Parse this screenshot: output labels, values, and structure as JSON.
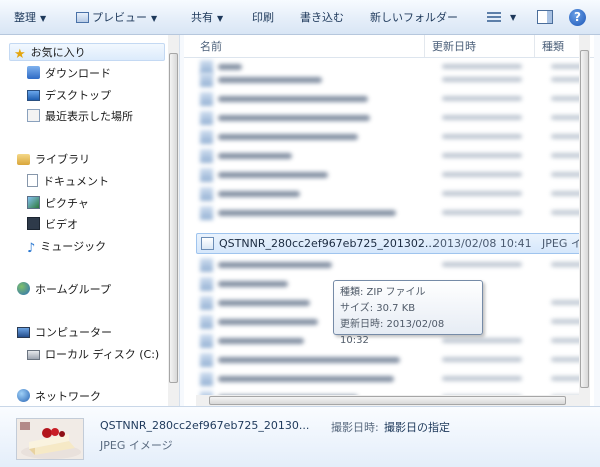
{
  "toolbar": {
    "organize_label": "整理",
    "preview_label": "プレビュー",
    "share_label": "共有",
    "print_label": "印刷",
    "burn_label": "書き込む",
    "new_folder_label": "新しいフォルダー",
    "help_glyph": "?"
  },
  "nav": {
    "favorites": {
      "label": "お気に入り",
      "items": [
        {
          "label": "ダウンロード"
        },
        {
          "label": "デスクトップ"
        },
        {
          "label": "最近表示した場所"
        }
      ]
    },
    "libraries": {
      "label": "ライブラリ",
      "items": [
        {
          "label": "ドキュメント"
        },
        {
          "label": "ピクチャ"
        },
        {
          "label": "ビデオ"
        },
        {
          "label": "ミュージック"
        }
      ]
    },
    "homegroup": {
      "label": "ホームグループ"
    },
    "computer": {
      "label": "コンピューター",
      "items": [
        {
          "label": "ローカル ディスク (C:)"
        }
      ]
    },
    "network": {
      "label": "ネットワーク"
    }
  },
  "columns": {
    "name": "名前",
    "modified": "更新日時",
    "type": "種類"
  },
  "selected_file": {
    "name": "QSTNNR_280cc2ef967eb725_201302...",
    "date": "2013/02/08 10:41",
    "type": "JPEG イ"
  },
  "tooltip": {
    "type_line": "種類: ZIP ファイル",
    "size_line": "サイズ: 30.7 KB",
    "modified_line": "更新日時: 2013/02/08 10:32"
  },
  "details": {
    "file_name": "QSTNNR_280cc2ef967eb725_20130...",
    "prop_label": "撮影日時:",
    "prop_value": "撮影日の指定",
    "file_type": "JPEG イメージ"
  },
  "colors": {
    "accent": "#1e395b",
    "selection": "#d5e7fb",
    "selection_border": "#9fc4ee"
  }
}
